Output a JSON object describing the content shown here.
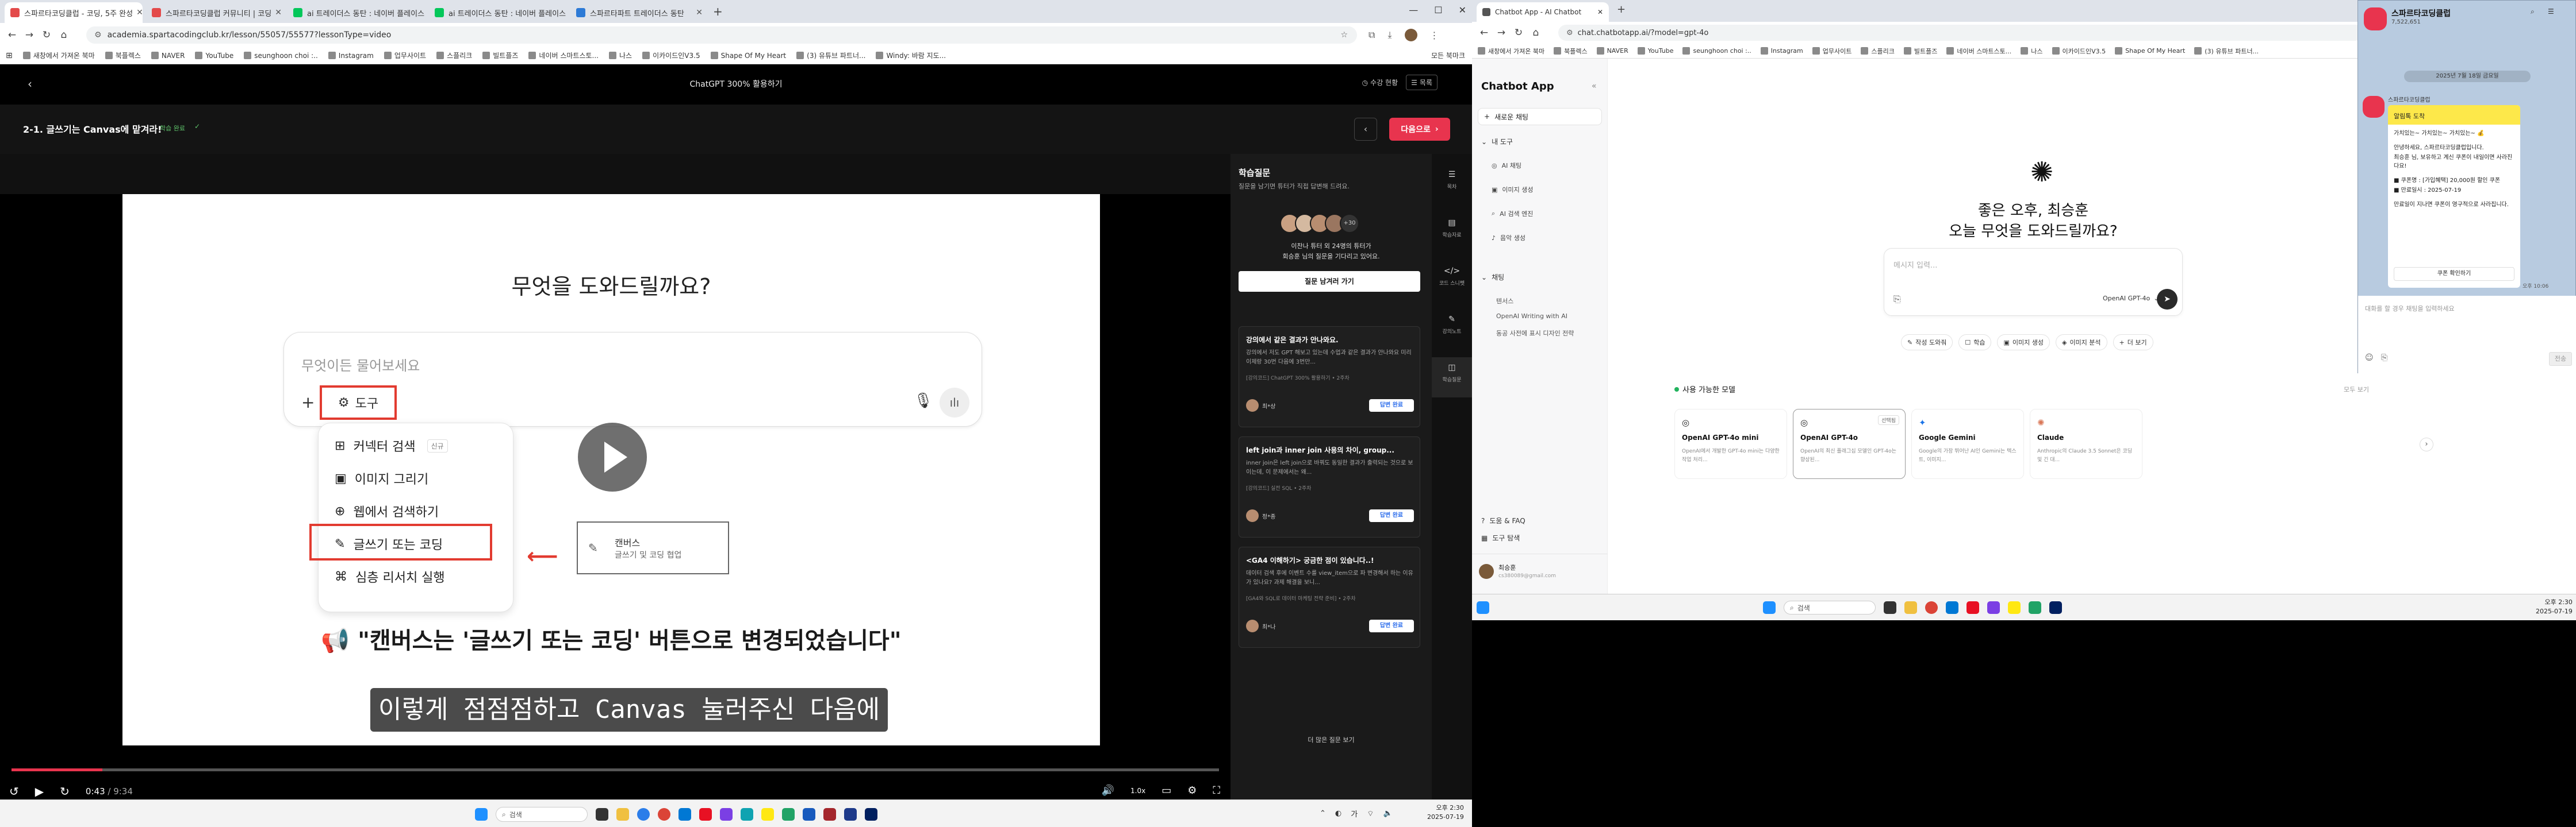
{
  "left_browser": {
    "tabs": [
      {
        "title": "스파르타코딩클럽 - 코딩, 5주 완성",
        "active": true,
        "color": "#e34a4a"
      },
      {
        "title": "스파르타코딩클럽 커뮤니티 | 코딩",
        "active": false,
        "color": "#e34a4a"
      },
      {
        "title": "ai 트레이더스 동탄 : 네이버 플레이스",
        "active": false,
        "color": "#03c75a"
      },
      {
        "title": "ai 트레이더스 동탄 : 네이버 플레이스",
        "active": false,
        "color": "#03c75a"
      },
      {
        "title": "스파르타파트 트레이더스 동탄",
        "active": false,
        "color": "#2d7ad6"
      }
    ],
    "url": "academia.spartacodingclub.kr/lesson/55057/55577?lessonType=video",
    "bookmarks": [
      "새창에서 가져온 북마",
      "북플렉스",
      "NAVER",
      "YouTube",
      "seunghoon choi :..",
      "Instagram",
      "업무사이트",
      "스플리크",
      "빌트플즈",
      "네이버 스마트스토...",
      "나스",
      "이카이드인V3.5",
      "Shape Of My Heart",
      "(3) 유튜브 파트너...",
      "Windy: 바람 지도..."
    ],
    "other_bookmarks": "모든 북마크"
  },
  "player": {
    "header_title": "ChatGPT 300% 활용하기",
    "header_right": [
      "수강 현황",
      "목록"
    ],
    "lesson_title": "2-1. 글쓰기는 Canvas에 맡겨라!",
    "lesson_badge": "학습 완료",
    "next_button": "다음으로",
    "slide_heading": "무엇을 도와드릴까요?",
    "slide_placeholder": "무엇이든 물어보세요",
    "tools_label": "도구",
    "menu": [
      {
        "label": "커넥터 검색",
        "badge": "신규"
      },
      {
        "label": "이미지 그리기",
        "badge": ""
      },
      {
        "label": "웹에서 검색하기",
        "badge": ""
      },
      {
        "label": "글쓰기 또는 코딩",
        "badge": ""
      },
      {
        "label": "심층 리서치 실행",
        "badge": ""
      }
    ],
    "canvas_box_title": "캔버스",
    "canvas_box_sub": "글쓰기 및 코딩 협업",
    "slide_caption": "📢 \"캔버스는 '글쓰기 또는 코딩' 버튼으로 변경되었습니다\"",
    "subtitle": "이렇게 점점점하고 Canvas 눌러주신 다음에",
    "time_current": "0:43",
    "time_total": "/ 9:34",
    "speed": "1.0x",
    "progress": 0.075
  },
  "qa": {
    "title": "학습질문",
    "desc": "질문을 남기면 튜터가 직접 답변해 드려요.",
    "count": "+30",
    "tutor_line1": "이찬나 튜터 외 24명의 튜터가",
    "tutor_line2": "회승훈 님의 질문을 기다리고 있어요.",
    "ask_button": "질문 남겨러 가기",
    "posts": [
      {
        "title": "강의에서 같은 결과가 안나와요.",
        "body": "강의에서 저도 GPT 해보고 있는데 수업과 같은 결과가 안나와요 미리 이제랑 30번 다음에 3번만...",
        "meta": "[강의코드] ChatGPT 300% 활용하기 • 2주차",
        "author": "최*상",
        "status": "답변 완료"
      },
      {
        "title": "left join과 inner join 사용의 차이, group...",
        "body": "inner join은 left join으로 바꿔도 동일한 결과가 출력되는 것으로 보이는데, 이 문제에서는 왜...",
        "meta": "[강의코드] 실전 SQL • 2주차",
        "author": "정*종",
        "status": "답변 완료"
      },
      {
        "title": "<GA4 이해하기> 궁금한 점이 있습니다..!",
        "body": "데이터 검색 후에 이벤트 수를 view_item으로 파 변경해서 하는 이유가 있나요? 과제 해결을 보니...",
        "meta": "[GA4와 SQL로 데이터 마케팅 전략 준비] • 2주차",
        "author": "최*나",
        "status": "답변 완료"
      }
    ],
    "more": "더 많은 질문 보기"
  },
  "rail": [
    "목차",
    "학습자료",
    "코드 스니펫",
    "강의노트",
    "학습질문"
  ],
  "left_taskbar": {
    "search": "검색",
    "time": "오후 2:30",
    "date": "2025-07-19",
    "lang": "가"
  },
  "right_browser": {
    "tab_title": "Chatbot App - AI Chatbot",
    "url": "chat.chatbotapp.ai/?model=gpt-4o",
    "other_bookmarks": "모든 북마크"
  },
  "chatbot": {
    "app_title": "Chatbot App",
    "new_chat": "새로운 채팅",
    "my_tools": "내 도구",
    "tools": [
      "AI 채팅",
      "이미지 생성",
      "AI 검색 엔진",
      "음악 생성"
    ],
    "chats_label": "채팅",
    "chats": [
      "텐서스",
      "OpenAI Writing with AI",
      "동공 사전에 표시 디자인 전략"
    ],
    "help": "도움 & FAQ",
    "tour": "도구 탐색",
    "user_name": "최승훈",
    "user_email": "cs380089@gmail.com",
    "greet1": "좋은 오후, 최승훈",
    "greet2": "오늘 무엇을 도와드릴까요?",
    "placeholder": "메시지 입력...",
    "model_select": "OpenAI GPT-4o",
    "chips": [
      "작성 도와줘",
      "학습",
      "이미지 생성",
      "이미지 분석",
      "더 보기"
    ],
    "models_header": "사용 가능한 모델",
    "models_more": "모두 보기",
    "models": [
      {
        "name": "OpenAI GPT-4o mini",
        "desc": "OpenAI에서 개발한 GPT-4o mini는 다양한 작업 처리...",
        "tag": ""
      },
      {
        "name": "OpenAI GPT-4o",
        "desc": "OpenAI의 최신 플래그십 모델인 GPT-4o는 향상된...",
        "tag": "선택됨"
      },
      {
        "name": "Google Gemini",
        "desc": "Google의 가장 뛰어난 AI인 Gemini는 텍스트, 이미지...",
        "tag": ""
      },
      {
        "name": "Claude",
        "desc": "Anthropic의 Claude 3.5 Sonnet은 코딩 및 긴 대...",
        "tag": ""
      }
    ]
  },
  "kakao": {
    "room": "스파르타코딩클럽",
    "members": "7,522,651",
    "date_divider": "2025년 7월 18일 금요일",
    "sender": "스파르타코딩클럽",
    "banner": "알림톡 도착",
    "lines": [
      "가치있는~ 가치있는~ 가치있는~ 💰",
      "안녕하세요, 스파르타코딩클럽입니다.",
      "최승훈 님, 보유하고 계신 쿠폰이 내일이면 사라진다요!",
      "■ 쿠폰명 : [가입혜택] 20,000원 할인 쿠폰",
      "■ 만료일시 : 2025-07-19",
      "만료일이 지나면 쿠폰이 영구적으로 사라집니다."
    ],
    "button": "쿠폰 확인하기",
    "msg_time": "오후 10:06",
    "input_placeholder": "대화를 할 경우 채팅을 입력하세요",
    "send": "전송"
  },
  "right_taskbar": {
    "search": "검색",
    "time": "오후 2:30",
    "date": "2025-07-19"
  }
}
